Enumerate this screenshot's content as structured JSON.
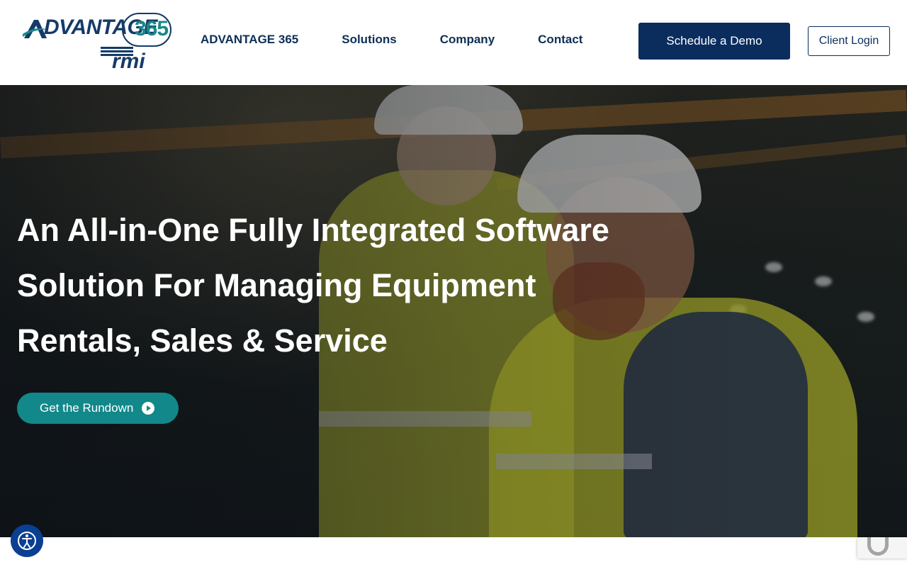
{
  "header": {
    "logo": {
      "brand_top": "DVANTAGE",
      "brand_initial": "A",
      "brand_number": "365",
      "brand_sub": "rmi"
    },
    "nav": [
      {
        "label": "ADVANTAGE 365"
      },
      {
        "label": "Solutions"
      },
      {
        "label": "Company"
      },
      {
        "label": "Contact"
      }
    ],
    "demo_button": "Schedule a Demo",
    "login_button": "Client Login"
  },
  "hero": {
    "title_line1": "An All-in-One Fully Integrated Software",
    "title_line2": "Solution For Managing Equipment",
    "title_line3": "Rentals, Sales & Service",
    "cta_label": "Get the Rundown"
  },
  "icons": {
    "cta": "play-circle-icon",
    "accessibility": "accessibility-icon",
    "recaptcha": "recaptcha-icon"
  },
  "colors": {
    "navy": "#0a2d5e",
    "teal": "#12888a",
    "accessibility_blue": "#0a3f91"
  }
}
